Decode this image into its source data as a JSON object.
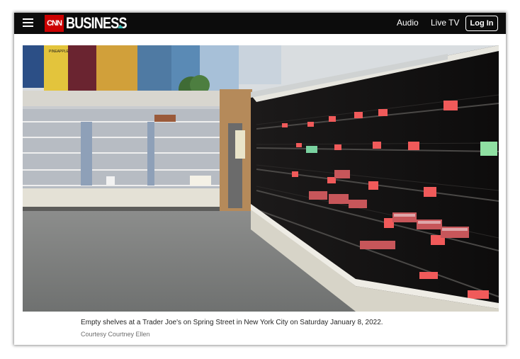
{
  "header": {
    "logo_box": "CNN",
    "logo_text": "BUSINESS",
    "nav": {
      "audio": "Audio",
      "live_tv": "Live TV",
      "login": "Log In"
    }
  },
  "photo": {
    "subject": "Empty grocery store shelves",
    "mural_sign": "PINEAPPLE"
  },
  "caption": {
    "text": "Empty shelves at a Trader Joe's on Spring Street in New York City on Saturday January 8, 2022.",
    "credit": "Courtesy Courtney Ellen"
  },
  "colors": {
    "header_bg": "#0c0c0c",
    "brand_red": "#cc0000",
    "accent_teal": "#2cb7b0"
  }
}
